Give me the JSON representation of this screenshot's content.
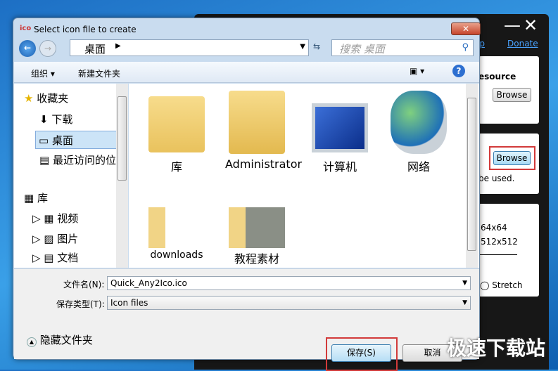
{
  "app": {
    "help_link": "lp",
    "donate_link": "Donate",
    "resource_label": "esource",
    "browse1": "Browse",
    "browse2": "Browse",
    "used_text": "be used.",
    "size1": "64x64",
    "size2": "512x512",
    "stretch": "Stretch"
  },
  "dialog": {
    "title": "Select icon file to create",
    "address": "桌面",
    "search_placeholder": "搜索 桌面",
    "toolbar": {
      "organize": "组织 ▾",
      "new_folder": "新建文件夹"
    },
    "nav": [
      {
        "label": "收藏夹"
      },
      {
        "label": "下载"
      },
      {
        "label": "桌面"
      },
      {
        "label": "最近访问的位置"
      },
      {
        "label": "库"
      },
      {
        "label": "视频"
      },
      {
        "label": "图片"
      },
      {
        "label": "文档"
      }
    ],
    "files": [
      {
        "label": "库"
      },
      {
        "label": "Administrator"
      },
      {
        "label": "计算机"
      },
      {
        "label": "网络"
      },
      {
        "label": "downloads"
      },
      {
        "label": "教程素材"
      }
    ],
    "filename_label": "文件名(N):",
    "filename_value": "Quick_Any2Ico.ico",
    "type_label": "保存类型(T):",
    "type_value": "Icon files",
    "hide_folders": "隐藏文件夹",
    "save": "保存(S)",
    "cancel": "取消"
  },
  "watermark": "极速下载站"
}
